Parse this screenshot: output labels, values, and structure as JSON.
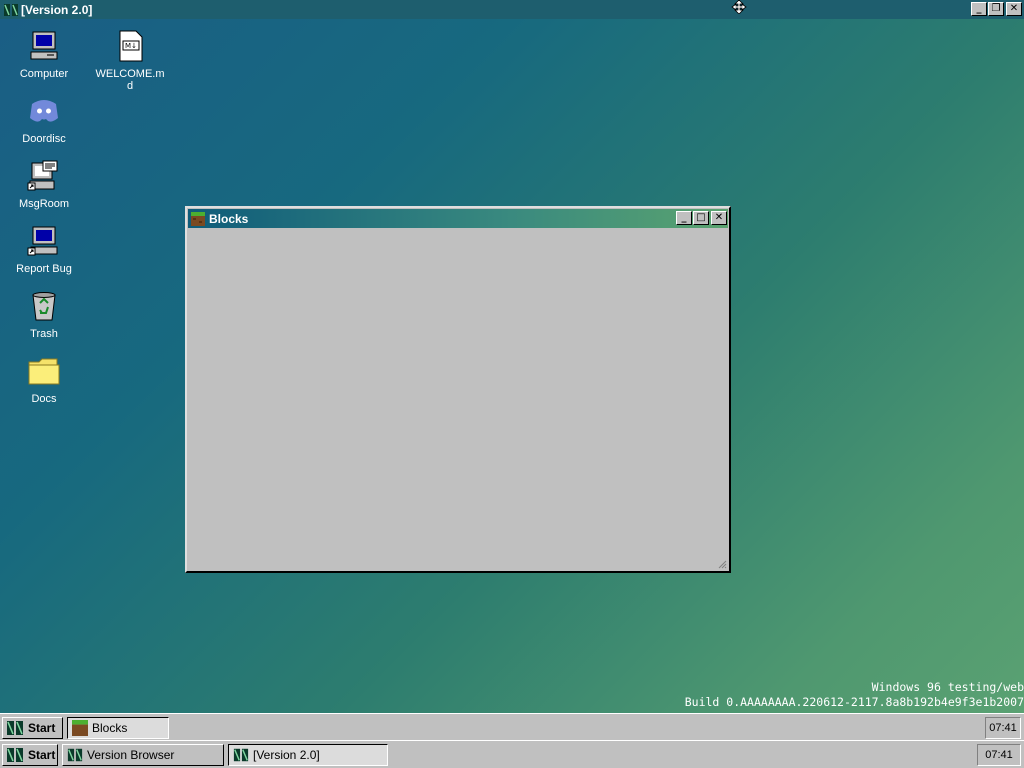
{
  "outer_window": {
    "title": "[Version 2.0]"
  },
  "desktop_icons": [
    {
      "label": "Computer",
      "icon": "computer-icon"
    },
    {
      "label": "WELCOME.md",
      "icon": "markdown-file-icon"
    },
    {
      "label": "Doordisc",
      "icon": "discord-icon"
    },
    {
      "label": "MsgRoom",
      "icon": "msgroom-icon"
    },
    {
      "label": "Report Bug",
      "icon": "report-bug-icon"
    },
    {
      "label": "Trash",
      "icon": "trash-icon"
    },
    {
      "label": "Docs",
      "icon": "folder-icon"
    }
  ],
  "blocks_window": {
    "title": "Blocks"
  },
  "build_info": {
    "line1": "Windows 96 testing/web",
    "line2": "Build 0.AAAAAAAA.220612-2117.8a8b192b4e9f3e1b2007"
  },
  "inner_taskbar": {
    "start_label": "Start",
    "tasks": [
      {
        "label": "Blocks",
        "icon": "blocks-icon"
      }
    ],
    "clock": "07:41"
  },
  "outer_taskbar": {
    "start_label": "Start",
    "tasks": [
      {
        "label": "Version Browser"
      },
      {
        "label": "[Version 2.0]",
        "icon": "w96-logo-icon"
      }
    ],
    "clock": "07:41"
  },
  "colors": {
    "desktop_gradient_start": "#1a5e85",
    "desktop_gradient_end": "#5aa172",
    "window_face": "#c0c0c0"
  }
}
